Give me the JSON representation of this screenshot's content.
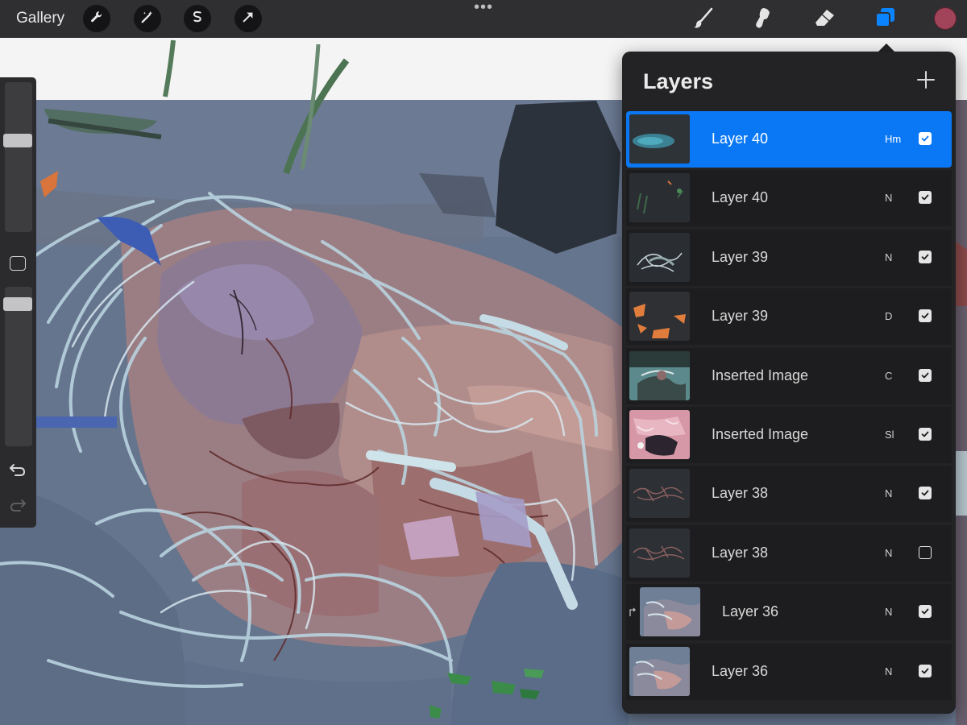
{
  "topbar": {
    "gallery_label": "Gallery",
    "left_tools": [
      {
        "icon": "wrench-icon",
        "name": "actions-button"
      },
      {
        "icon": "magic-wand-icon",
        "name": "adjustments-button"
      },
      {
        "icon": "selection-icon",
        "name": "selection-button"
      },
      {
        "icon": "arrow-icon",
        "name": "transform-button"
      }
    ],
    "more_menu": "•••",
    "right_tools": [
      {
        "icon": "brush-icon",
        "name": "paint-tool"
      },
      {
        "icon": "smudge-icon",
        "name": "smudge-tool"
      },
      {
        "icon": "eraser-icon",
        "name": "eraser-tool"
      },
      {
        "icon": "layers-icon",
        "name": "layers-tool",
        "active": true
      }
    ],
    "current_color": "#a24459",
    "accent_color": "#0a84ff"
  },
  "sidebar": {
    "brush_size_level": 0.62,
    "brush_opacity_level": 0.93,
    "undo_icon": "undo-icon",
    "redo_icon": "redo-icon"
  },
  "layers_panel": {
    "title": "Layers",
    "add_icon": "plus-icon",
    "layers": [
      {
        "name": "Layer 40",
        "blend": "Hm",
        "visible": true,
        "active": true,
        "clipped": false,
        "thumb": "teal-smudge"
      },
      {
        "name": "Layer 40",
        "blend": "N",
        "visible": true,
        "active": false,
        "clipped": false,
        "thumb": "dark-grass"
      },
      {
        "name": "Layer 39",
        "blend": "N",
        "visible": true,
        "active": false,
        "clipped": false,
        "thumb": "sketch-light"
      },
      {
        "name": "Layer 39",
        "blend": "D",
        "visible": true,
        "active": false,
        "clipped": false,
        "thumb": "orange-shapes"
      },
      {
        "name": "Inserted Image",
        "blend": "C",
        "visible": true,
        "active": false,
        "clipped": false,
        "thumb": "teal-figure"
      },
      {
        "name": "Inserted Image",
        "blend": "Sl",
        "visible": true,
        "active": false,
        "clipped": false,
        "thumb": "pink-figure"
      },
      {
        "name": "Layer 38",
        "blend": "N",
        "visible": true,
        "active": false,
        "clipped": false,
        "thumb": "dark-sketch"
      },
      {
        "name": "Layer 38",
        "blend": "N",
        "visible": false,
        "active": false,
        "clipped": false,
        "thumb": "dark-sketch"
      },
      {
        "name": "Layer 36",
        "blend": "N",
        "visible": true,
        "active": false,
        "clipped": true,
        "thumb": "painted-figure"
      },
      {
        "name": "Layer 36",
        "blend": "N",
        "visible": true,
        "active": false,
        "clipped": false,
        "thumb": "painted-figure"
      }
    ]
  }
}
